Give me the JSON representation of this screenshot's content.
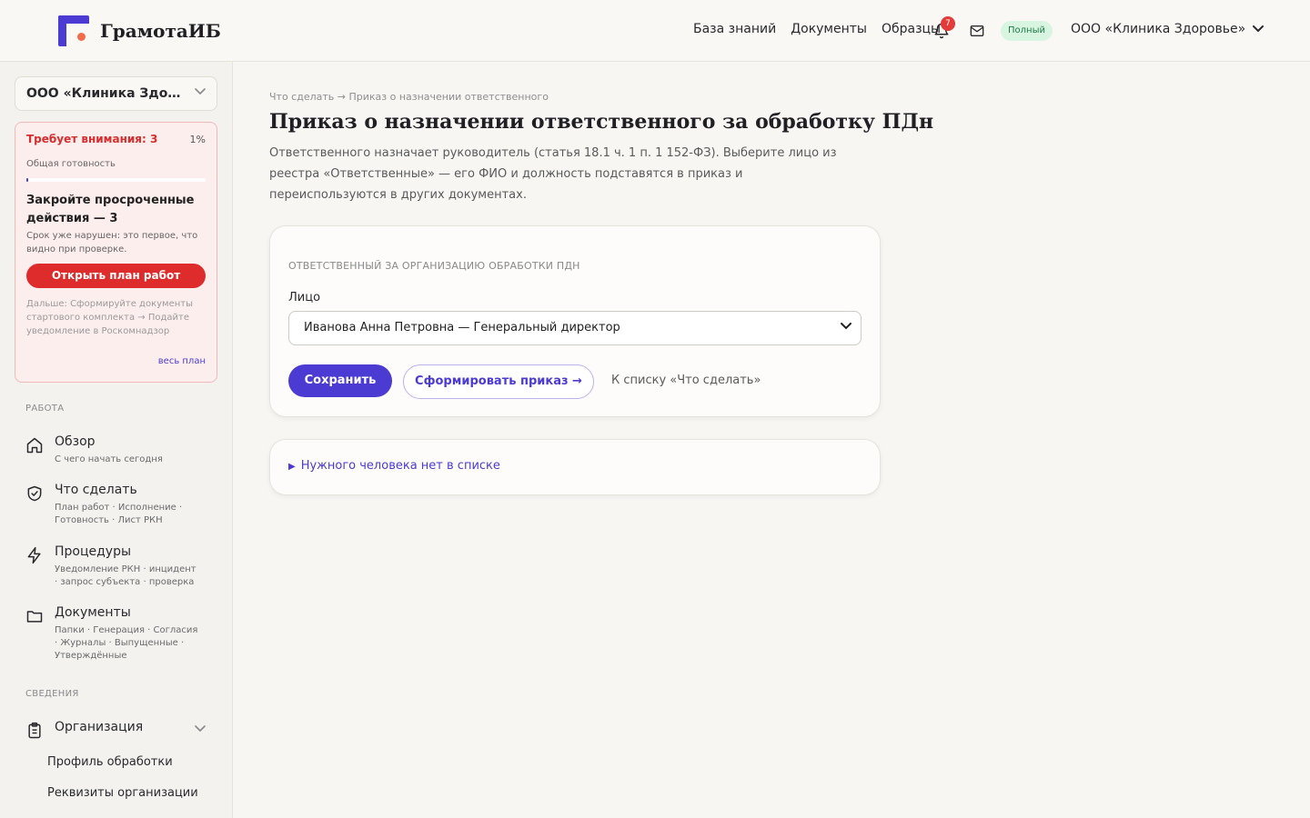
{
  "brand": {
    "name": "ГрамотаИБ"
  },
  "topnav": {
    "items": [
      "База знаний",
      "Документы",
      "Образцы"
    ],
    "notifications_count": "7",
    "plan_badge": "Полный",
    "org_name": "ООО «Клиника Здоровье»"
  },
  "sidebar": {
    "org_select": "ООО «Клиника Здоровье»",
    "alert": {
      "title": "Требует внимания: 3",
      "percent": "1%",
      "readiness_label": "Общая готовность",
      "readiness_fraction": 0.01,
      "heading": "Закройте просроченные действия — 3",
      "description": "Срок уже нарушен: это первое, что видно при проверке.",
      "button": "Открыть план работ",
      "next": "Дальше: Сформируйте документы стартового комплекта → Подайте уведомление в Роскомнадзор",
      "all_plan_link": "весь план"
    },
    "section_work": "РАБОТА",
    "work_items": [
      {
        "title": "Обзор",
        "sub": "С чего начать сегодня"
      },
      {
        "title": "Что сделать",
        "sub": "План работ · Исполнение · Готовность · Лист РКН"
      },
      {
        "title": "Процедуры",
        "sub": "Уведомление РКН · инцидент · запрос субъекта · проверка"
      },
      {
        "title": "Документы",
        "sub": "Папки · Генерация · Согласия · Журналы · Выпущенные · Утверждённые"
      }
    ],
    "section_info": "СВЕДЕНИЯ",
    "info_item": {
      "title": "Организация"
    },
    "info_subitems": [
      "Профиль обработки",
      "Реквизиты организации"
    ]
  },
  "main": {
    "breadcrumb": "Что сделать → Приказ о назначении ответственного",
    "title": "Приказ о назначении ответственного за обработку ПДн",
    "description": "Ответственного назначает руководитель (статья 18.1 ч. 1 п. 1 152-ФЗ). Выберите лицо из реестра «Ответственные» — его ФИО и должность подставятся в приказ и переиспользуются в других документах.",
    "card": {
      "section_label": "ОТВЕТСТВЕННЫЙ ЗА ОРГАНИЗАЦИЮ ОБРАБОТКИ ПДН",
      "field_label": "Лицо",
      "selected_person": "Иванова Анна Петровна — Генеральный директор",
      "save_button": "Сохранить",
      "generate_button": "Сформировать приказ →",
      "back_link": "К списку «Что сделать»"
    },
    "disclosure": "Нужного человека нет в списке"
  },
  "colors": {
    "accent": "#4b3bd3",
    "danger": "#de2b2b",
    "logo_dot": "#f26b4a",
    "plan_badge_bg": "#d8f5e2"
  },
  "icons": [
    "bell-icon",
    "mail-icon",
    "chevron-down-icon",
    "home-icon",
    "shield-check-icon",
    "bolt-icon",
    "folder-icon",
    "clipboard-icon"
  ]
}
